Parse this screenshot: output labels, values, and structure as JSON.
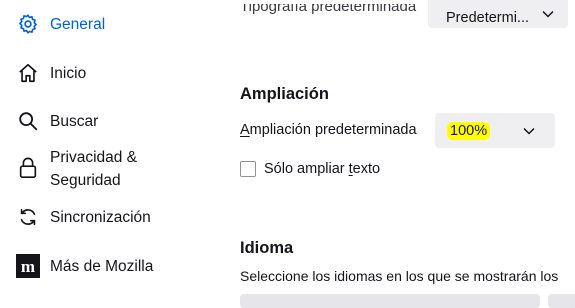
{
  "sidebar": {
    "items": [
      {
        "label": "General",
        "icon": "gear-icon"
      },
      {
        "label": "Inicio",
        "icon": "home-icon"
      },
      {
        "label": "Buscar",
        "icon": "search-icon"
      },
      {
        "label_line1": "Privacidad &",
        "label_line2": "Seguridad",
        "icon": "lock-icon"
      },
      {
        "label": "Sincronización",
        "icon": "sync-icon"
      },
      {
        "label": "Más de Mozilla",
        "icon": "mozilla-icon"
      }
    ]
  },
  "top": {
    "label": "Tipografía predeterminada",
    "select_value": "Predetermi..."
  },
  "zoom": {
    "heading": "Ampliación",
    "default_label_first": "A",
    "default_label_rest": "mpliación predeterminada",
    "select_value": "100%",
    "checkbox_prefix": "Sólo ampliar ",
    "checkbox_underlined": "t",
    "checkbox_suffix": "exto",
    "checkbox_checked": false
  },
  "language": {
    "heading": "Idioma",
    "description": "Seleccione los idiomas en los que se mostrarán los"
  },
  "colors": {
    "accent": "#0061e0",
    "highlight": "#ffff00",
    "select_bg": "#efeff2"
  }
}
